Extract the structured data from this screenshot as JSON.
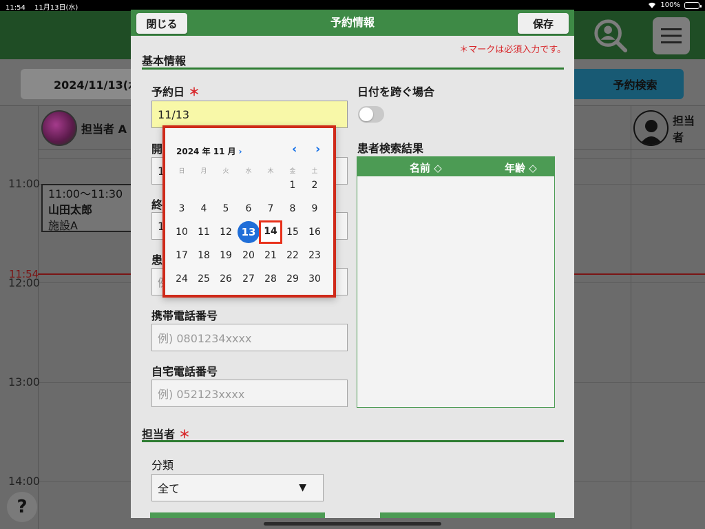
{
  "status": {
    "time": "11:54",
    "date": "11月13日(水)",
    "battery": "100%"
  },
  "background": {
    "date_button": "2024/11/13(水",
    "search_button": "予約検索",
    "staff": [
      {
        "name": "担当者 A",
        "avatar": "flower-photo"
      },
      {
        "name": "担当者",
        "avatar": "person-silhouette-icon"
      }
    ],
    "times": [
      "11:00",
      "12:00",
      "13:00",
      "14:00"
    ],
    "now_label": "11:54",
    "appointment": {
      "time": "11:00～11:30",
      "name": "山田太郎",
      "place": "施設A"
    },
    "help": "?"
  },
  "modal": {
    "title": "予約情報",
    "close_label": "閉じる",
    "save_label": "保存",
    "required_note": "＊マークは必須入力です。",
    "required_mark": "＊",
    "section_basic": "基本情報",
    "section_staff": "担当者",
    "reserve_date_label": "予約日",
    "reserve_date_value": "11/13",
    "start_label": "開",
    "start_value": "1",
    "end_label": "終",
    "end_value": "1",
    "patient_label": "患",
    "patient_placeholder": "例",
    "mobile_label": "携帯電話番号",
    "mobile_placeholder": "例) 0801234xxxx",
    "home_label": "自宅電話番号",
    "home_placeholder": "例) 052123xxxx",
    "crossing_label": "日付を跨ぐ場合",
    "search_result_label": "患者検索結果",
    "col_name": "名前 ◇",
    "col_age": "年齢 ◇",
    "category_label": "分類",
    "category_value": "全て",
    "select_arrow": "▼"
  },
  "picker": {
    "month": "2024 年 11 月",
    "month_chevron": "›",
    "prev": "‹",
    "next": "›",
    "weekdays": [
      "日",
      "月",
      "火",
      "水",
      "木",
      "金",
      "土"
    ],
    "days": [
      "1",
      "2",
      "3",
      "4",
      "5",
      "6",
      "7",
      "8",
      "9",
      "10",
      "11",
      "12",
      "13",
      "14",
      "15",
      "16",
      "17",
      "18",
      "19",
      "20",
      "21",
      "22",
      "23",
      "24",
      "25",
      "26",
      "27",
      "28",
      "29",
      "30"
    ],
    "today": "13",
    "selected": "14"
  },
  "colors": {
    "header_green": "#3e8a46",
    "accent_blue": "#1f6ed8",
    "highlight_red": "#cf2a1a",
    "required_red": "#d8272b"
  }
}
